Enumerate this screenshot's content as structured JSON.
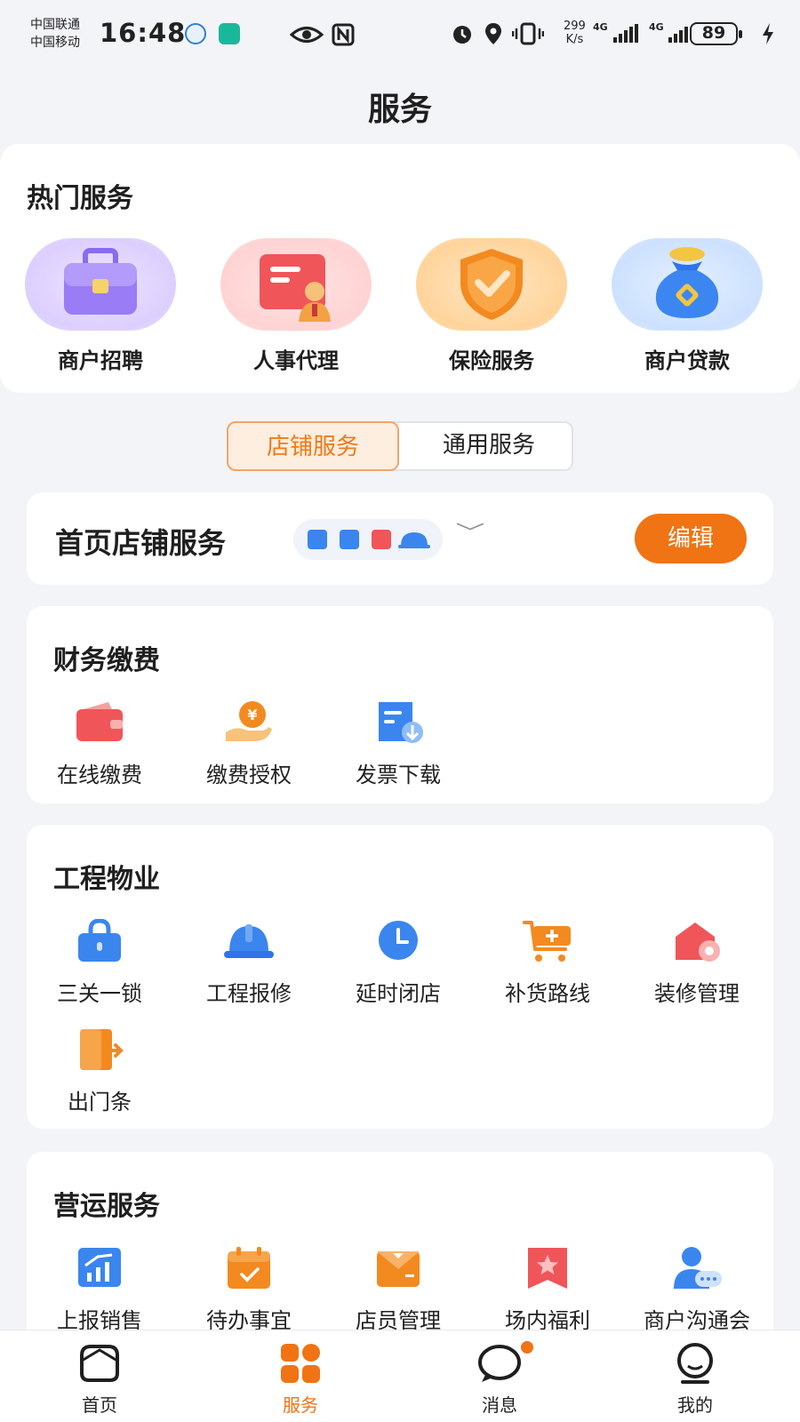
{
  "status_bar": {
    "carrier_1": "中国联通",
    "carrier_2": "中国移动",
    "time": "16:48",
    "speed_value": "299",
    "speed_unit": "K/s",
    "network_1": "4G",
    "network_2": "4G",
    "battery": "89"
  },
  "page": {
    "title": "服务"
  },
  "hot_services": {
    "title": "热门服务",
    "items": [
      {
        "label": "商户招聘",
        "icon": "briefcase-icon"
      },
      {
        "label": "人事代理",
        "icon": "id-card-icon"
      },
      {
        "label": "保险服务",
        "icon": "shield-check-icon"
      },
      {
        "label": "商户贷款",
        "icon": "money-bag-icon"
      }
    ]
  },
  "segment": {
    "active": "店铺服务",
    "inactive": "通用服务"
  },
  "shop_services": {
    "title": "首页店铺服务",
    "edit": "编辑"
  },
  "finance": {
    "title": "财务缴费",
    "items": [
      {
        "label": "在线缴费",
        "icon": "wallet-icon"
      },
      {
        "label": "缴费授权",
        "icon": "hand-coin-icon"
      },
      {
        "label": "发票下载",
        "icon": "invoice-download-icon"
      }
    ]
  },
  "engineering": {
    "title": "工程物业",
    "items": [
      {
        "label": "三关一锁",
        "icon": "lock-icon"
      },
      {
        "label": "工程报修",
        "icon": "hard-hat-icon"
      },
      {
        "label": "延时闭店",
        "icon": "clock-icon"
      },
      {
        "label": "补货路线",
        "icon": "cart-icon"
      },
      {
        "label": "装修管理",
        "icon": "house-gear-icon"
      },
      {
        "label": "出门条",
        "icon": "exit-door-icon"
      }
    ]
  },
  "operations": {
    "title": "营运服务",
    "items": [
      {
        "label": "上报销售",
        "icon": "chart-up-icon"
      },
      {
        "label": "待办事宜",
        "icon": "calendar-icon"
      },
      {
        "label": "店员管理",
        "icon": "staff-icon"
      },
      {
        "label": "场内福利",
        "icon": "star-ribbon-icon"
      },
      {
        "label": "商户沟通会",
        "icon": "user-chat-icon"
      }
    ]
  },
  "bottom_nav": {
    "items": [
      {
        "label": "首页"
      },
      {
        "label": "服务"
      },
      {
        "label": "消息"
      },
      {
        "label": "我的"
      }
    ]
  },
  "colors": {
    "accent": "#f07314",
    "blue": "#3a86ee",
    "background": "#f3f4f8"
  }
}
